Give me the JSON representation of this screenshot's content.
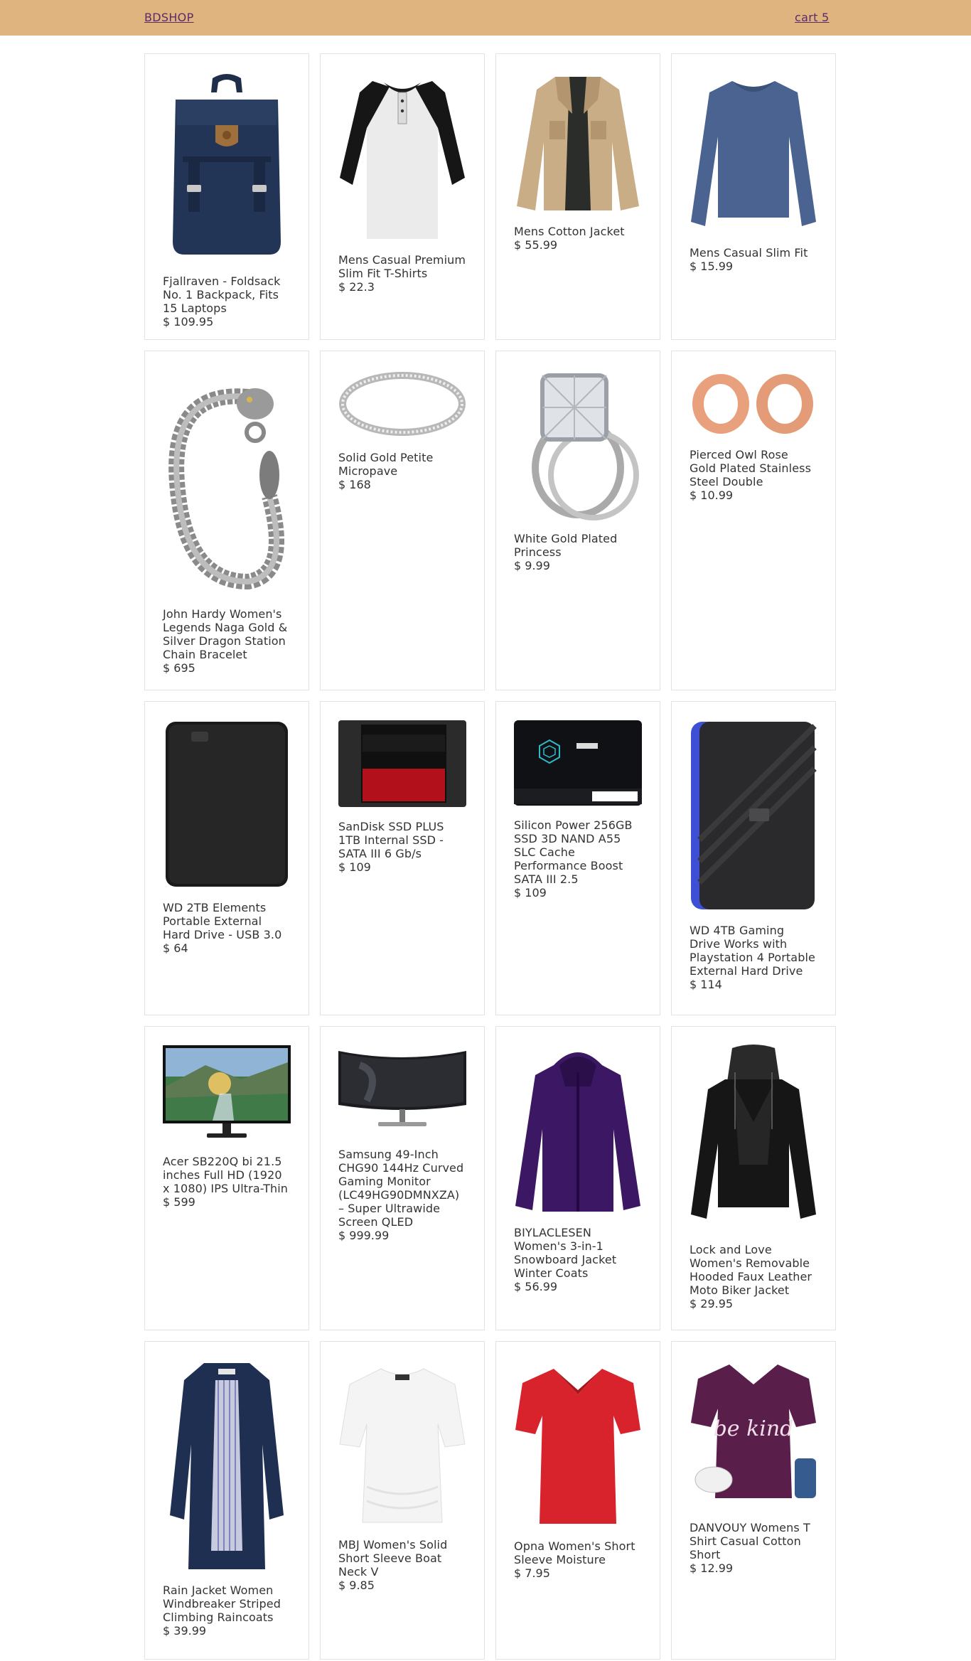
{
  "header": {
    "brand": "BDSHOP",
    "cart": "cart 5"
  },
  "products": [
    {
      "title": "Fjallraven - Foldsack No. 1 Backpack, Fits 15 Laptops",
      "price": "$ 109.95",
      "icon": "backpack-icon"
    },
    {
      "title": "Mens Casual Premium Slim Fit T-Shirts",
      "price": "$ 22.3",
      "icon": "raglan-tshirt-icon"
    },
    {
      "title": "Mens Cotton Jacket",
      "price": "$ 55.99",
      "icon": "cotton-jacket-icon"
    },
    {
      "title": "Mens Casual Slim Fit",
      "price": "$ 15.99",
      "icon": "long-sleeve-shirt-icon"
    },
    {
      "title": "John Hardy Women's Legends Naga Gold & Silver Dragon Station Chain Bracelet",
      "price": "$ 695",
      "icon": "dragon-bracelet-icon"
    },
    {
      "title": "Solid Gold Petite Micropave",
      "price": "$ 168",
      "icon": "ring-icon"
    },
    {
      "title": "White Gold Plated Princess",
      "price": "$ 9.99",
      "icon": "diamond-ring-icon"
    },
    {
      "title": "Pierced Owl Rose Gold Plated Stainless Steel Double",
      "price": "$ 10.99",
      "icon": "ear-tunnel-icon"
    },
    {
      "title": "WD 2TB Elements Portable External Hard Drive - USB 3.0",
      "price": "$ 64",
      "icon": "hard-drive-icon"
    },
    {
      "title": "SanDisk SSD PLUS 1TB Internal SSD - SATA III 6 Gb/s",
      "price": "$ 109",
      "icon": "ssd-icon"
    },
    {
      "title": "Silicon Power 256GB SSD 3D NAND A55 SLC Cache Performance Boost SATA III 2.5",
      "price": "$ 109",
      "icon": "ssd-icon"
    },
    {
      "title": "WD 4TB Gaming Drive Works with Playstation 4 Portable External Hard Drive",
      "price": "$ 114",
      "icon": "gaming-drive-icon"
    },
    {
      "title": "Acer SB220Q bi 21.5 inches Full HD (1920 x 1080) IPS Ultra-Thin",
      "price": "$ 599",
      "icon": "monitor-icon"
    },
    {
      "title": "Samsung 49-Inch CHG90 144Hz Curved Gaming Monitor (LC49HG90DMNXZA) – Super Ultrawide Screen QLED",
      "price": "$ 999.99",
      "icon": "curved-monitor-icon"
    },
    {
      "title": "BIYLACLESEN Women's 3-in-1 Snowboard Jacket Winter Coats",
      "price": "$ 56.99",
      "icon": "snowboard-jacket-icon"
    },
    {
      "title": "Lock and Love Women's Removable Hooded Faux Leather Moto Biker Jacket",
      "price": "$ 29.95",
      "icon": "leather-jacket-icon"
    },
    {
      "title": "Rain Jacket Women Windbreaker Striped Climbing Raincoats",
      "price": "$ 39.99",
      "icon": "raincoat-icon"
    },
    {
      "title": "MBJ Women's Solid Short Sleeve Boat Neck V",
      "price": "$ 9.85",
      "icon": "white-top-icon"
    },
    {
      "title": "Opna Women's Short Sleeve Moisture",
      "price": "$ 7.95",
      "icon": "red-tshirt-icon"
    },
    {
      "title": "DANVOUY Womens T Shirt Casual Cotton Short",
      "price": "$ 12.99",
      "icon": "purple-tshirt-icon",
      "print": "be kind"
    }
  ]
}
